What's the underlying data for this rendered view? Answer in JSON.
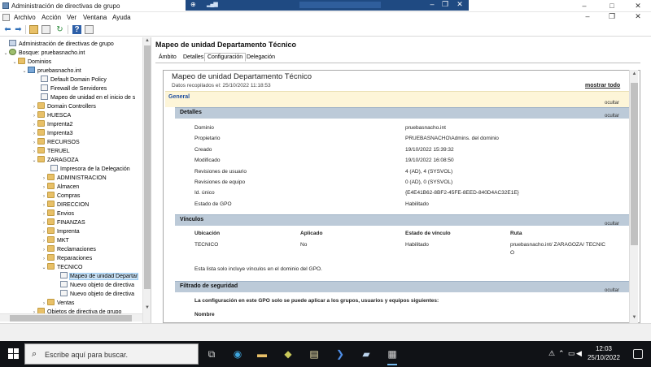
{
  "window": {
    "title": "Administración de directivas de grupo",
    "controls": {
      "minimize": "–",
      "maximize": "□",
      "close": "✕"
    }
  },
  "remote_bar": {
    "signal": "▂▄▆",
    "pin": "⊕",
    "minimize": "–",
    "restore": "❐",
    "close": "✕"
  },
  "menu": {
    "items": [
      "Archivo",
      "Acción",
      "Ver",
      "Ventana",
      "Ayuda"
    ],
    "window_controls": {
      "minimize": "–",
      "restore": "❐",
      "close": "✕"
    }
  },
  "toolbar": {
    "icons": [
      "back-arrow-icon",
      "forward-arrow-icon",
      "folder-icon",
      "properties-icon",
      "refresh-icon",
      "help-icon",
      "view-icon"
    ]
  },
  "tree": {
    "items": [
      {
        "label": "Administración de directivas de grupo",
        "exp": "",
        "icon": "root"
      },
      {
        "label": "Bosque: pruebasnacho.int",
        "exp": "⌄",
        "icon": "forest"
      },
      {
        "label": "Dominios",
        "exp": "⌄",
        "icon": "folder"
      },
      {
        "label": "pruebasnacho.int",
        "exp": "⌄",
        "icon": "domain"
      },
      {
        "label": "Default Domain Policy",
        "exp": "",
        "icon": "doc"
      },
      {
        "label": "Firewall de Servidores",
        "exp": "",
        "icon": "doc"
      },
      {
        "label": "Mapeo de unidad en el inicio de s",
        "exp": "",
        "icon": "doc"
      },
      {
        "label": "Domain Controllers",
        "exp": "›",
        "icon": "folder"
      },
      {
        "label": "HUESCA",
        "exp": "›",
        "icon": "folder"
      },
      {
        "label": "Imprenta2",
        "exp": "›",
        "icon": "folder"
      },
      {
        "label": "Imprenta3",
        "exp": "›",
        "icon": "folder"
      },
      {
        "label": "RECURSOS",
        "exp": "›",
        "icon": "folder"
      },
      {
        "label": "TERUEL",
        "exp": "›",
        "icon": "folder"
      },
      {
        "label": "ZARAGOZA",
        "exp": "⌄",
        "icon": "folder"
      },
      {
        "label": "Impresora de la Delegación",
        "exp": "",
        "icon": "doc"
      },
      {
        "label": "ADMINISTRACION",
        "exp": "›",
        "icon": "folder"
      },
      {
        "label": "Almacen",
        "exp": "›",
        "icon": "folder"
      },
      {
        "label": "Compras",
        "exp": "›",
        "icon": "folder"
      },
      {
        "label": "DIRECCION",
        "exp": "›",
        "icon": "folder"
      },
      {
        "label": "Envios",
        "exp": "›",
        "icon": "folder"
      },
      {
        "label": "FINANZAS",
        "exp": "›",
        "icon": "folder"
      },
      {
        "label": "Imprenta",
        "exp": "›",
        "icon": "folder"
      },
      {
        "label": "MKT",
        "exp": "›",
        "icon": "folder"
      },
      {
        "label": "Reclamaciones",
        "exp": "›",
        "icon": "folder"
      },
      {
        "label": "Reparaciones",
        "exp": "›",
        "icon": "folder"
      },
      {
        "label": "TECNICO",
        "exp": "⌄",
        "icon": "folder"
      },
      {
        "label": "Mapeo de unidad Departar",
        "exp": "",
        "icon": "doc"
      },
      {
        "label": "Nuevo objeto de directiva",
        "exp": "",
        "icon": "doc"
      },
      {
        "label": "Nuevo objeto de directiva",
        "exp": "",
        "icon": "doc"
      },
      {
        "label": "Ventas",
        "exp": "›",
        "icon": "folder"
      },
      {
        "label": "Objetos de directiva de grupo",
        "exp": "›",
        "icon": "folder"
      }
    ]
  },
  "right": {
    "title": "Mapeo de unidad Departamento Técnico",
    "tabs": [
      "Ámbito",
      "Detalles",
      "Configuración",
      "Delegación"
    ],
    "active_tab": "Configuración"
  },
  "report": {
    "title": "Mapeo de unidad Departamento Técnico",
    "date": "Datos recopilados el: 25/10/2022 11:18:53",
    "show_all": "mostrar todo",
    "hide": "ocultar",
    "general": "General",
    "details": {
      "heading": "Detalles",
      "rows": [
        {
          "key": "Dominio",
          "value": "pruebasnacho.int"
        },
        {
          "key": "Propietario",
          "value": "PRUEBASNACHO\\Admins. del dominio"
        },
        {
          "key": "Creado",
          "value": "19/10/2022 15:39:32"
        },
        {
          "key": "Modificado",
          "value": "19/10/2022 16:08:50"
        },
        {
          "key": "Revisiones de usuario",
          "value": "4 (AD), 4 (SYSVOL)"
        },
        {
          "key": "Revisiones de equipo",
          "value": "0 (AD), 0 (SYSVOL)"
        },
        {
          "key": "Id. único",
          "value": "{E4E41B62-8BF2-45FE-8EED-840D4AC32E1E}"
        },
        {
          "key": "Estado de GPO",
          "value": "Habilitado"
        }
      ]
    },
    "links": {
      "heading": "Vínculos",
      "columns": [
        "Ubicación",
        "Aplicado",
        "Estado de vínculo",
        "Ruta"
      ],
      "row": {
        "ubicacion": "TECNICO",
        "aplicado": "No",
        "estado": "Habilitado",
        "ruta_1": "pruebasnacho.int/ ZARAGOZA/ TECNIC",
        "ruta_2": "O"
      },
      "note": "Esta lista solo incluye vínculos en el dominio del GPO."
    },
    "security": {
      "heading": "Filtrado de seguridad",
      "text": "La configuración en este GPO solo se puede aplicar a los grupos, usuarios y equipos siguientes:",
      "column": "Nombre"
    }
  },
  "taskbar": {
    "search_placeholder": "Escribe aquí para buscar.",
    "time": "12:03",
    "date": "25/10/2022"
  }
}
